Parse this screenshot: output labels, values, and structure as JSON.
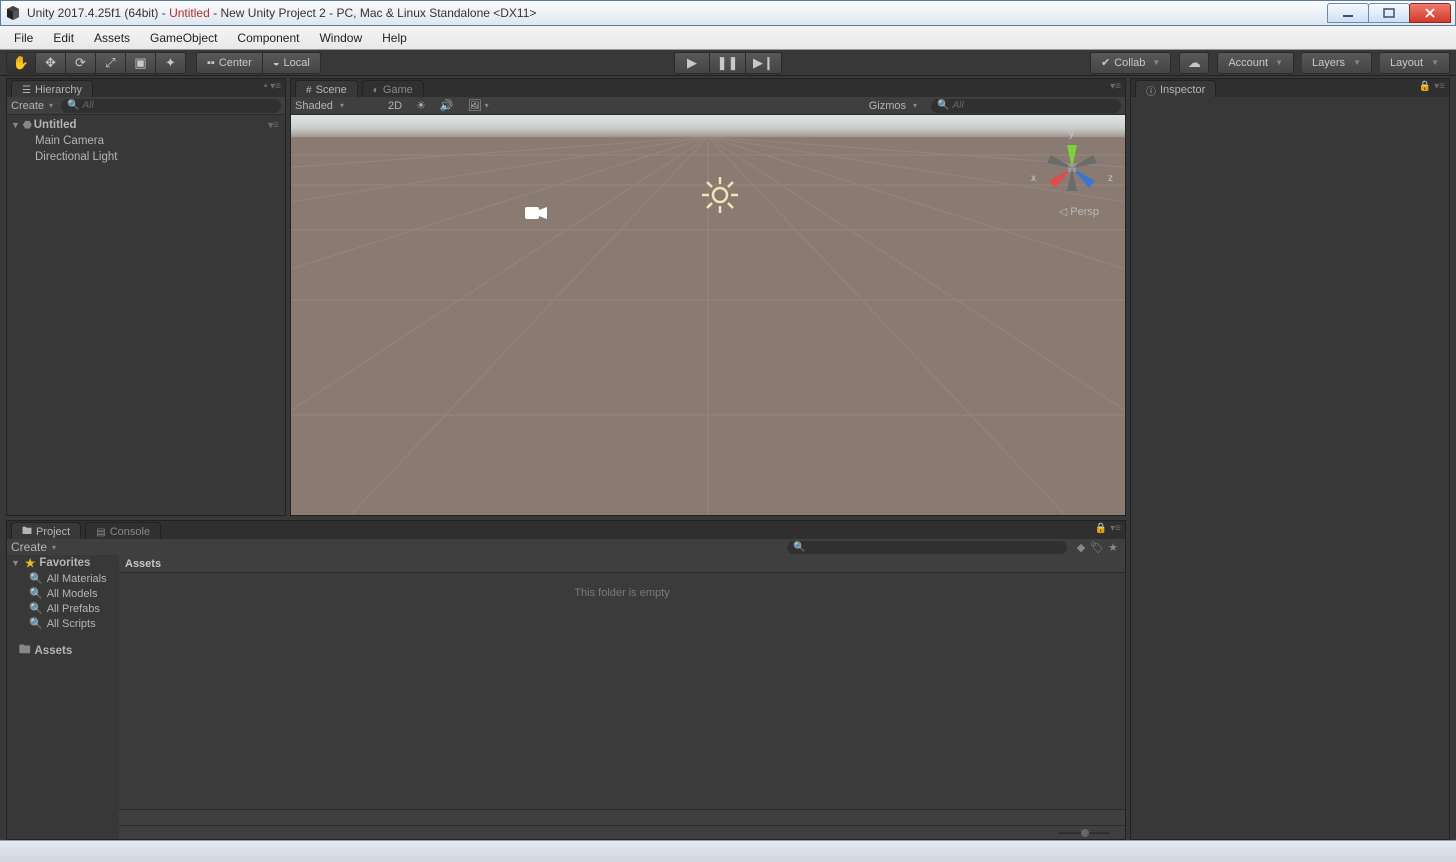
{
  "title": {
    "app": "Unity 2017.4.25f1 (64bit)",
    "doc": "Untitled",
    "proj": "New Unity Project 2",
    "target": "PC, Mac & Linux Standalone",
    "gfx": "DX11"
  },
  "menu": [
    "File",
    "Edit",
    "Assets",
    "GameObject",
    "Component",
    "Window",
    "Help"
  ],
  "toolbar": {
    "pivot": "Center",
    "handle": "Local",
    "collab": "Collab",
    "account": "Account",
    "layers": "Layers",
    "layout": "Layout"
  },
  "hierarchy": {
    "tab": "Hierarchy",
    "create": "Create",
    "search": "All",
    "scene": "Untitled",
    "items": [
      "Main Camera",
      "Directional Light"
    ]
  },
  "sceneTabs": {
    "scene": "Scene",
    "game": "Game"
  },
  "sceneToolbar": {
    "shading": "Shaded",
    "mode2d": "2D",
    "gizmos": "Gizmos",
    "search": "All"
  },
  "sceneView": {
    "projection": "Persp",
    "axes": {
      "x": "x",
      "y": "y",
      "z": "z"
    }
  },
  "project": {
    "tabProject": "Project",
    "tabConsole": "Console",
    "create": "Create",
    "favorites": "Favorites",
    "favItems": [
      "All Materials",
      "All Models",
      "All Prefabs",
      "All Scripts"
    ],
    "assets": "Assets",
    "breadcrumb": "Assets",
    "empty": "This folder is empty"
  },
  "inspector": {
    "tab": "Inspector"
  }
}
